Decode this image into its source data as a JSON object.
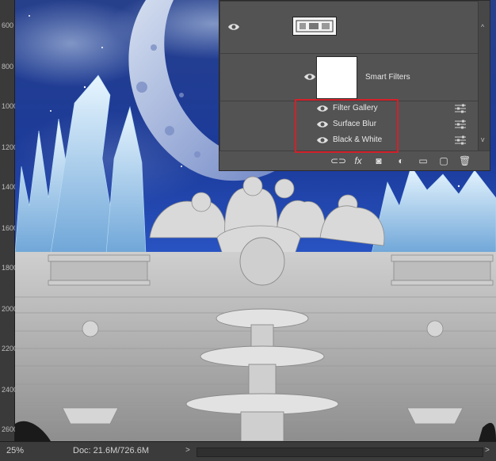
{
  "ruler": {
    "marks": [
      "600",
      "800",
      "1000",
      "1200",
      "1400",
      "1600",
      "1800",
      "2000",
      "2200",
      "2400",
      "2600"
    ]
  },
  "layers_panel": {
    "smart_filters_label": "Smart Filters",
    "filters": [
      {
        "label": "Filter Gallery"
      },
      {
        "label": "Surface Blur"
      },
      {
        "label": "Black & White"
      }
    ],
    "footer_icons": [
      "link-icon",
      "fx-icon",
      "mask-icon",
      "adjustment-icon",
      "folder-icon",
      "new-layer-icon",
      "trash-icon"
    ]
  },
  "status": {
    "zoom": "25%",
    "doc": "Doc: 21.6M/726.6M"
  },
  "colors": {
    "sky": "#1f3f8f",
    "panel": "#535353",
    "highlight": "#d4202a"
  }
}
